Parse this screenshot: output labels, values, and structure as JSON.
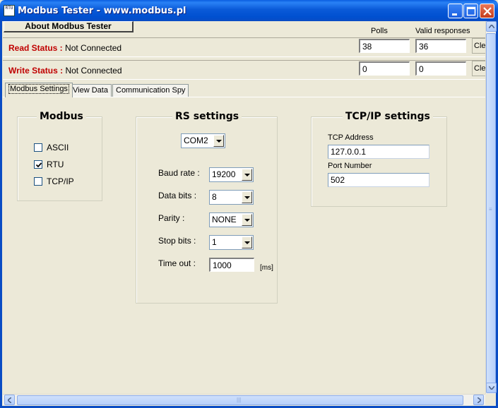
{
  "window": {
    "title": "Modbus Tester - www.modbus.pl",
    "icon_text": "RTU"
  },
  "toolbar": {
    "about_label": "About Modbus Tester",
    "polls_header": "Polls",
    "valid_header": "Valid responses",
    "clear_label": "Cle"
  },
  "read_status": {
    "label": "Read Status :",
    "value": "Not Connected",
    "polls": "38",
    "valid": "36"
  },
  "write_status": {
    "label": "Write Status :",
    "value": "Not Connected",
    "polls": "0",
    "valid": "0"
  },
  "tabs": [
    {
      "label": "Modbus Settings",
      "active": true
    },
    {
      "label": "View Data",
      "active": false
    },
    {
      "label": "Communication Spy",
      "active": false
    }
  ],
  "modbus": {
    "title": "Modbus",
    "options": [
      {
        "label": "ASCII",
        "checked": false
      },
      {
        "label": "RTU",
        "checked": true
      },
      {
        "label": "TCP/IP",
        "checked": false
      }
    ]
  },
  "rs": {
    "title": "RS settings",
    "port": "COM2",
    "baud_label": "Baud rate :",
    "baud": "19200",
    "databits_label": "Data bits :",
    "databits": "8",
    "parity_label": "Parity :",
    "parity": "NONE",
    "stopbits_label": "Stop bits :",
    "stopbits": "1",
    "timeout_label": "Time out :",
    "timeout": "1000",
    "timeout_unit": "[ms]"
  },
  "tcp": {
    "title": "TCP/IP settings",
    "address_label": "TCP Address",
    "address": "127.0.0.1",
    "port_label": "Port Number",
    "port": "502"
  },
  "colors": {
    "titlebar": "#0a5ad8",
    "status_label": "#c00000",
    "window_bg": "#ece9d8"
  }
}
